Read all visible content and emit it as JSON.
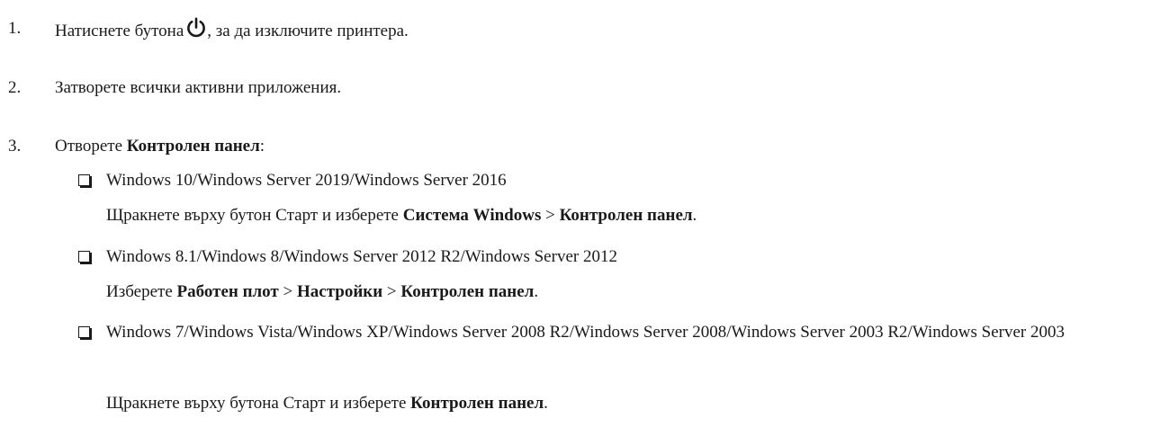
{
  "steps": [
    {
      "num": "1.",
      "before": "Натиснете бутона",
      "after": ", за да изключите принтера.",
      "icon": "power-icon"
    },
    {
      "num": "2.",
      "text": "Затворете всички активни приложения."
    },
    {
      "num": "3.",
      "prefix": "Отворете ",
      "bold": "Контролен панел",
      "suffix": ":"
    }
  ],
  "options": [
    {
      "os": "Windows 10/Windows Server 2019/Windows Server 2016",
      "instr_1": "Щракнете върху бутон Старт и изберете ",
      "bold_1": "Система Windows",
      "sep_1": " > ",
      "bold_2": "Контролен панел",
      "end": "."
    },
    {
      "os": "Windows 8.1/Windows 8/Windows Server 2012 R2/Windows Server 2012",
      "instr_1": "Изберете ",
      "bold_1": "Работен плот",
      "sep_1": " > ",
      "bold_2": "Настройки",
      "sep_2": " > ",
      "bold_3": "Контролен панел",
      "end": "."
    },
    {
      "os": "Windows 7/Windows Vista/Windows XP/Windows Server 2008 R2/Windows Server 2008/Windows Server 2003 R2/Windows Server 2003",
      "instr_1": "Щракнете върху бутона Старт и изберете ",
      "bold_1": "Контролен панел",
      "end": "."
    }
  ]
}
